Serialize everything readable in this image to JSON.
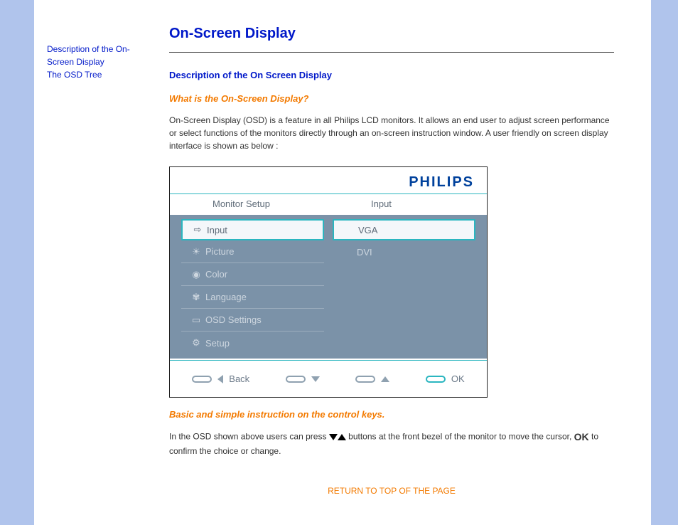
{
  "sidebar": {
    "links": [
      "Description of the On-Screen Display",
      "The OSD Tree"
    ]
  },
  "main": {
    "title": "On-Screen Display",
    "section_heading": "Description of the On Screen Display",
    "q_heading": "What is the On-Screen Display?",
    "intro_paragraph": "On-Screen Display (OSD) is a feature in all Philips LCD monitors. It allows an end user to adjust screen performance or select functions of the monitors directly through an on-screen instruction window. A user friendly on screen display interface is shown as below :",
    "instr_heading": "Basic and simple instruction on the control keys.",
    "instr_part1": "In the OSD shown above users can press",
    "instr_part2": "buttons at the front bezel of the monitor to move the cursor,",
    "instr_ok": "OK",
    "instr_part3": "to confirm the choice or change.",
    "return_label": "RETURN TO TOP OF THE PAGE"
  },
  "osd": {
    "brand": "PHILIPS",
    "col1_header": "Monitor Setup",
    "col2_header": "Input",
    "left_items": [
      {
        "label": "Input",
        "icon": "input-icon",
        "selected": true
      },
      {
        "label": "Picture",
        "icon": "brightness-icon",
        "selected": false
      },
      {
        "label": "Color",
        "icon": "globe-icon",
        "selected": false
      },
      {
        "label": "Language",
        "icon": "language-icon",
        "selected": false
      },
      {
        "label": "OSD Settings",
        "icon": "screen-icon",
        "selected": false
      },
      {
        "label": "Setup",
        "icon": "gear-icon",
        "selected": false
      }
    ],
    "right_items": [
      {
        "label": "VGA",
        "selected": true
      },
      {
        "label": "DVI",
        "selected": false
      }
    ],
    "back_label": "Back",
    "ok_label": "OK"
  }
}
